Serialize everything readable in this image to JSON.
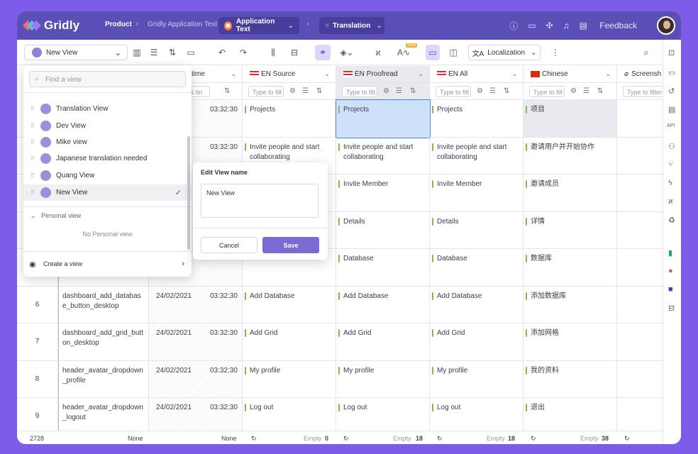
{
  "topbar": {
    "app_name": "Gridly",
    "breadcrumbs": [
      "Product",
      "Gridly Application Text"
    ],
    "db_pill": "Application Text",
    "branch_pill": "Translation",
    "feedback": "Feedback"
  },
  "toolbar": {
    "view_name": "New View",
    "beta": "Beta",
    "localization": "Localization"
  },
  "grid": {
    "columns": [
      {
        "name": "time"
      },
      {
        "name": "EN Source",
        "filter": "Type to filt"
      },
      {
        "name": "EN Proofread",
        "filter": "Type to filt"
      },
      {
        "name": "EN All",
        "filter": "Type to filt"
      },
      {
        "name": "Chinese",
        "filter": "Type to filt"
      },
      {
        "name": "Screensh",
        "filter": "Type to filter"
      }
    ],
    "time_filter": "e & tin",
    "rows": [
      {
        "num": "",
        "id": "",
        "date": "",
        "time": "03:32:30",
        "src": "Projects",
        "proof": "Projects",
        "all": "Projects",
        "zh": "项目"
      },
      {
        "num": "",
        "id": "",
        "date": "",
        "time": "03:32:30",
        "src": "Invite people and start collaborating",
        "proof": "Invite people and start collaborating",
        "all": "Invite people and start collaborating",
        "zh": "邀请用户并开始协作"
      },
      {
        "num": "",
        "id": "",
        "date": "",
        "time": "",
        "src": "",
        "proof": "Invite Member",
        "all": "Invite Member",
        "zh": "邀请成员"
      },
      {
        "num": "",
        "id": "",
        "date": "",
        "time": "",
        "src": "",
        "proof": "Details",
        "all": "Details",
        "zh": "详情"
      },
      {
        "num": "",
        "id": "",
        "date": "",
        "time": "",
        "src": "",
        "proof": "Database",
        "all": "Database",
        "zh": "数据库"
      },
      {
        "num": "6",
        "id": "dashboard_add_database_button_desktop",
        "date": "24/02/2021",
        "time": "03:32:30",
        "src": "Add Database",
        "proof": "Add Database",
        "all": "Add Database",
        "zh": "添加数据库"
      },
      {
        "num": "7",
        "id": "dashboard_add_grid_button_desktop",
        "date": "24/02/2021",
        "time": "03:32:30",
        "src": "Add Grid",
        "proof": "Add Grid",
        "all": "Add Grid",
        "zh": "添加网格"
      },
      {
        "num": "8",
        "id": "header_avatar_dropdown_profile",
        "date": "24/02/2021",
        "time": "03:32:30",
        "src": "My profile",
        "proof": "My profile",
        "all": "My profile",
        "zh": "我的资料"
      },
      {
        "num": "9",
        "id": "header_avatar_dropdown_logout",
        "date": "24/02/2021",
        "time": "03:32:30",
        "src": "Log out",
        "proof": "Log out",
        "all": "Log out",
        "zh": "退出"
      }
    ]
  },
  "footer": {
    "count": "2728",
    "none1": "None",
    "none2": "None",
    "empty_label": "Empty",
    "empty_src": "0",
    "empty_proof": "18",
    "empty_all": "18",
    "empty_zh": "38"
  },
  "views_dropdown": {
    "search_placeholder": "Find a view",
    "items": [
      "Translation View",
      "Dev View",
      "Mike view",
      "Japanese translation needed",
      "Quang View",
      "New View"
    ],
    "personal_header": "Personal view",
    "no_personal": "No Personal view",
    "create": "Create a view"
  },
  "edit_popup": {
    "label": "Edit View name",
    "value": "New View",
    "cancel": "Cancel",
    "save": "Save"
  },
  "colors": {
    "purple_bg": "#7c5ce8",
    "topbar": "#5a4fb4",
    "accent": "#7a6bd3",
    "green_status": "#7cc04b"
  }
}
